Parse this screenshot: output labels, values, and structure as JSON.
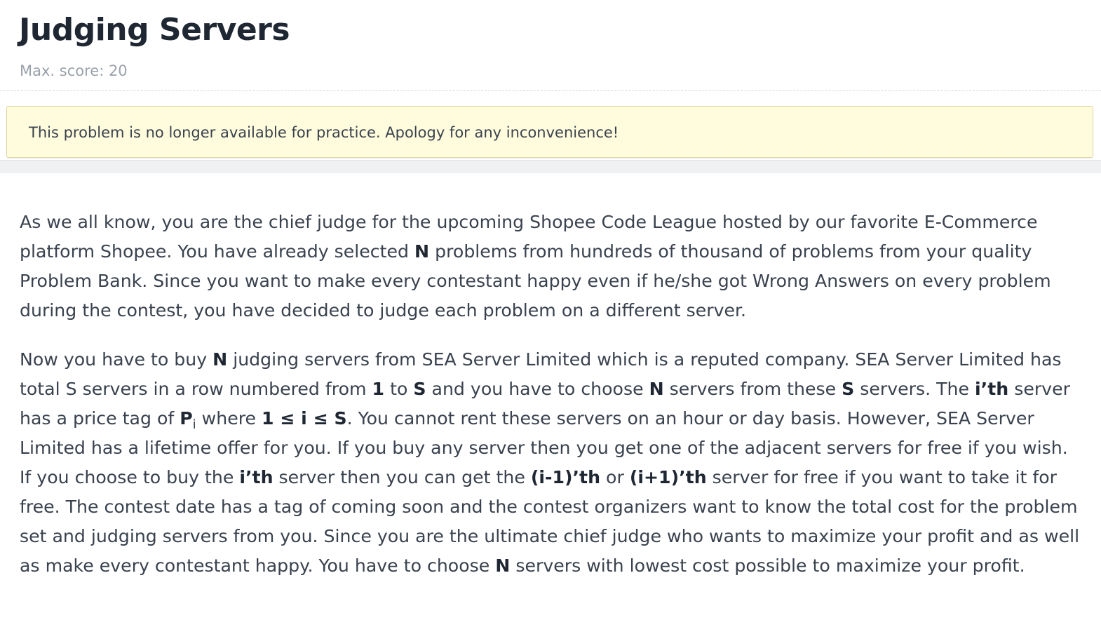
{
  "problem": {
    "title": "Judging Servers",
    "max_score": "Max. score: 20"
  },
  "notice": {
    "text": "This problem is no longer available for practice. Apology for any inconvenience!"
  },
  "statement": {
    "p1": {
      "t1": "As we all know, you are the chief judge for the upcoming Shopee Code League hosted by our favorite E-Commerce platform Shopee. You have already selected ",
      "b1": "N",
      "t2": " problems from hundreds of thousand of problems from your quality Problem Bank. Since you want to make every contestant happy even if he/she got Wrong Answers on every problem during the contest, you have decided to judge each problem on a different server."
    },
    "p2": {
      "t1": "Now you have to buy ",
      "b1": "N",
      "t2": " judging servers from SEA Server Limited which is a reputed company. SEA Server Limited has total S servers in a row numbered from ",
      "b2": "1",
      "t3": " to ",
      "b3": "S",
      "t4": " and you have to choose ",
      "b4": "N",
      "t5": " servers from these ",
      "b5": "S",
      "t6": " servers. The ",
      "b6": "i’th",
      "t7": " server has a price tag of ",
      "b7": "P",
      "sub7": "i",
      "t8": " where ",
      "b8": "1 ≤ i ≤ S",
      "t9": ". You cannot rent these servers on an hour or day basis. However, SEA Server Limited has a lifetime offer for you. If you buy any server then you get one of the adjacent servers for free if you wish. If you choose to buy the ",
      "b9": "i’th",
      "t10": " server then you can get the ",
      "b10": "(i-1)’th",
      "t11": " or ",
      "b11": "(i+1)’th",
      "t12": " server for free if you want to take it for free. The contest date has a tag of coming soon and the contest organizers want to know the total cost for the problem set and judging servers from you. Since you are the ultimate chief judge who wants to maximize your profit and as well as make every contestant happy. You have to choose ",
      "b12": "N",
      "t13": " servers with lowest cost possible to maximize your profit."
    }
  }
}
